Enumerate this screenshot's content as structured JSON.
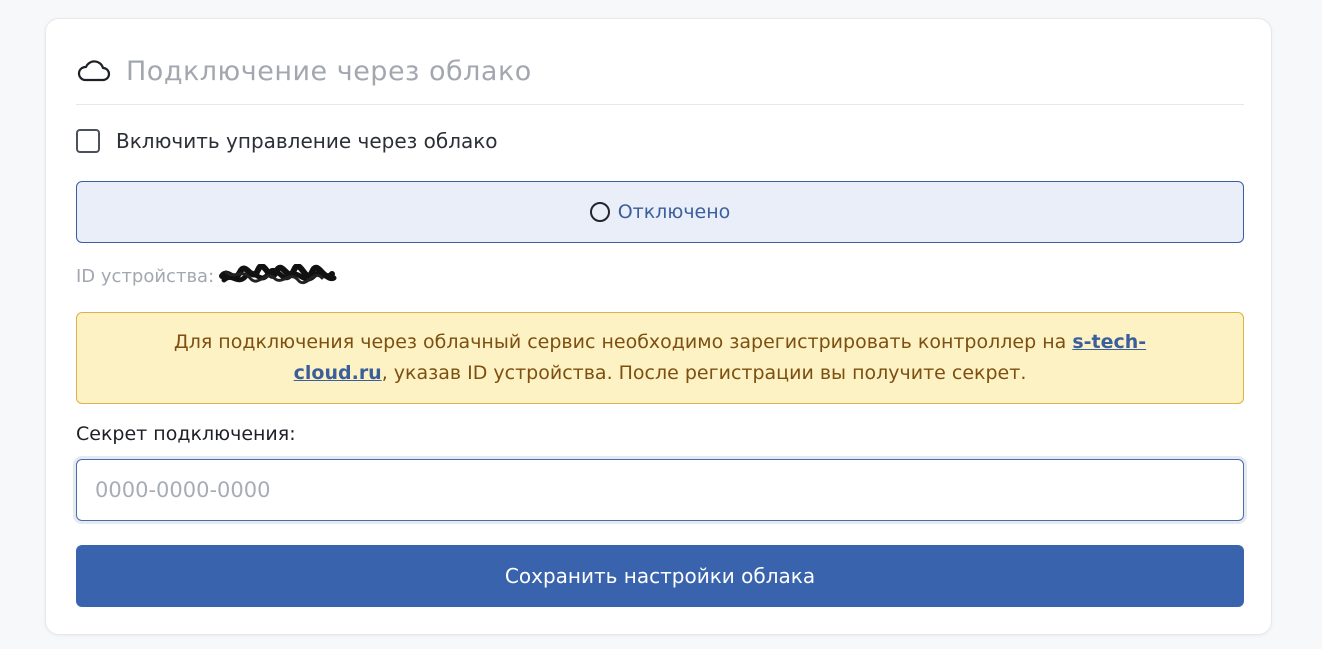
{
  "header": {
    "icon": "cloud-icon",
    "title": "Подключение через облако"
  },
  "cloud_toggle": {
    "label": "Включить управление через облако",
    "checked": false
  },
  "status": {
    "icon": "circle-icon",
    "text": "Отключено"
  },
  "device": {
    "label": "ID устройства:",
    "value": "████-████"
  },
  "notice": {
    "text_before": "Для подключения через облачный сервис необходимо зарегистрировать контроллер на ",
    "link_text": "s-tech-cloud.ru",
    "text_after": ", указав ID устройства. После регистрации вы получите секрет."
  },
  "secret": {
    "label": "Секрет подключения:",
    "placeholder": "0000-0000-0000",
    "value": ""
  },
  "save_button": {
    "label": "Сохранить настройки облака"
  },
  "colors": {
    "accent": "#3963ad",
    "status_bg": "#e9eef8",
    "notice_bg": "#fdf2c4",
    "notice_text": "#7d4f10"
  }
}
